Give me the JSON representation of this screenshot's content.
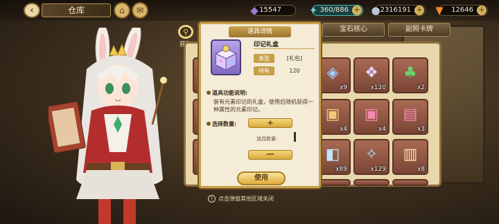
{
  "header": {
    "title": "仓库",
    "resources": [
      {
        "icon": "crystal-icon",
        "value": "15547"
      },
      {
        "icon": "stamina-icon",
        "value": "360/886"
      },
      {
        "icon": "coin-icon",
        "value": "2316191"
      },
      {
        "icon": "carrot-icon",
        "value": "12646"
      }
    ]
  },
  "side": {
    "fetch_label": "获取"
  },
  "tabs": [
    {
      "label": "宝石核心"
    },
    {
      "label": "副照卡牌"
    }
  ],
  "inventory": {
    "slots": [
      {
        "icon": "gem-icon",
        "qty": "x9"
      },
      {
        "icon": "gift-box-icon",
        "qty": "x120"
      },
      {
        "icon": "clover-icon",
        "qty": "x2"
      },
      {
        "icon": "box-icon",
        "qty": "x4"
      },
      {
        "icon": "box-icon",
        "qty": "x4"
      },
      {
        "icon": "box-icon",
        "qty": "x3"
      },
      {
        "icon": "chest-icon",
        "qty": "x89"
      },
      {
        "icon": "crystal-cluster-icon",
        "qty": "x129"
      },
      {
        "icon": "card-icon",
        "qty": "x8"
      }
    ]
  },
  "modal": {
    "title": "道具详情",
    "item_name": "印记礼盒",
    "type_key": "类型",
    "type_val": "[礼包]",
    "own_key": "持有",
    "own_val": "120",
    "desc_label": "道具功能说明:",
    "desc_text": "装有元素印记的礼盒，使用后随机获得一种属性的元素印记。",
    "select_label": "选择数量:",
    "plus": "+",
    "minus": "一",
    "qty_label": "道具数量:",
    "use_label": "使用"
  },
  "hint": {
    "text": "点击弹窗其他区域关闭"
  }
}
